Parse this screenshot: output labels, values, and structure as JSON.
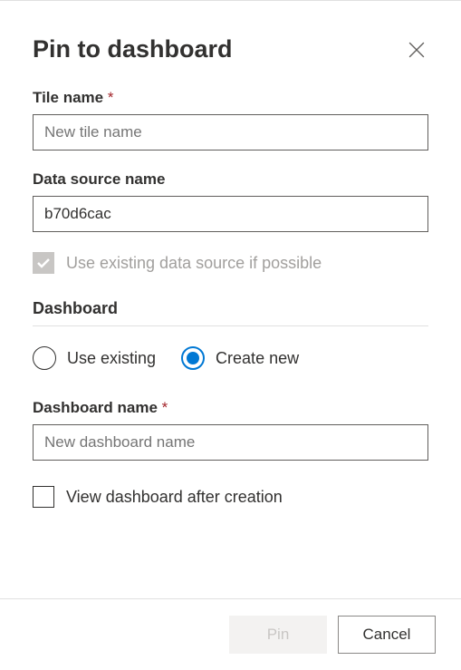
{
  "dialog": {
    "title": "Pin to dashboard"
  },
  "fields": {
    "tileName": {
      "label": "Tile name",
      "required": "*",
      "placeholder": "New tile name",
      "value": ""
    },
    "dataSourceName": {
      "label": "Data source name",
      "value": "b70d6cac"
    },
    "useExisting": {
      "label": "Use existing data source if possible"
    },
    "dashboardSection": {
      "header": "Dashboard"
    },
    "dashboardRadio": {
      "useExisting": "Use existing",
      "createNew": "Create new"
    },
    "dashboardName": {
      "label": "Dashboard name",
      "required": "*",
      "placeholder": "New dashboard name",
      "value": ""
    },
    "viewAfter": {
      "label": "View dashboard after creation"
    }
  },
  "buttons": {
    "pin": "Pin",
    "cancel": "Cancel"
  }
}
